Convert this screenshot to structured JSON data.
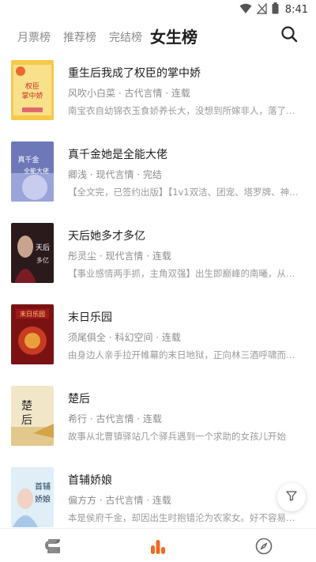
{
  "status_bar": {
    "time": "8:41",
    "icons": [
      "wifi-icon",
      "signal-off-icon",
      "battery-icon"
    ]
  },
  "tabs": [
    {
      "label": "月票榜",
      "active": false
    },
    {
      "label": "推荐榜",
      "active": false
    },
    {
      "label": "完结榜",
      "active": false
    },
    {
      "label": "女生榜",
      "active": true
    }
  ],
  "search_icon": "search-icon",
  "books": [
    {
      "title": "重生后我成了权臣的掌中娇",
      "meta": "风吹小白菜 · 古代言情 · 连载",
      "desc": "南宝衣自幼锦衣玉食娇养长大，没想到所嫁非人，落了个…",
      "cover_text": "权臣的掌中娇"
    },
    {
      "title": "真千金她是全能大佬",
      "meta": "卿浅 · 现代言情 · 完结",
      "desc": "【全文完，已签约出版】【1v1双洁、团宠、塔罗牌、神…",
      "cover_text": "真千金她是全能大佬"
    },
    {
      "title": "天后她多才多亿",
      "meta": "彤灵尘 · 现代言情 · 连载",
      "desc": "【事业感情两手抓，主角双强】出生即巅峰的南曦，从小…",
      "cover_text": "天后她多才多亿"
    },
    {
      "title": "末日乐园",
      "meta": "须尾俱全 · 科幻空间 · 连载",
      "desc": "由身边人亲手拉开帷幕的末日地狱，正向林三酒呼啸而来。",
      "cover_text": "末日乐园"
    },
    {
      "title": "楚后",
      "meta": "希行 · 古代言情 · 连载",
      "desc": "故事从北曹镇驿站几个驿兵遇到一个求助的女孩儿开始",
      "cover_text": "楚后"
    },
    {
      "title": "首辅娇娘",
      "meta": "偏方方 · 古代言情 · 连载",
      "desc": "本是侯府千金，却因出生时抱错沦为农家女。好不容易长…",
      "cover_text": "首辅娇娘"
    }
  ],
  "filter_icon": "filter-icon",
  "bottom_nav": [
    {
      "icon": "bookshelf-icon",
      "active": false
    },
    {
      "icon": "ranking-icon",
      "active": true
    },
    {
      "icon": "compass-icon",
      "active": false
    }
  ],
  "colors": {
    "accent": "#f06a23",
    "text_primary": "#1e1e1e",
    "text_secondary": "#8c8c8c"
  }
}
